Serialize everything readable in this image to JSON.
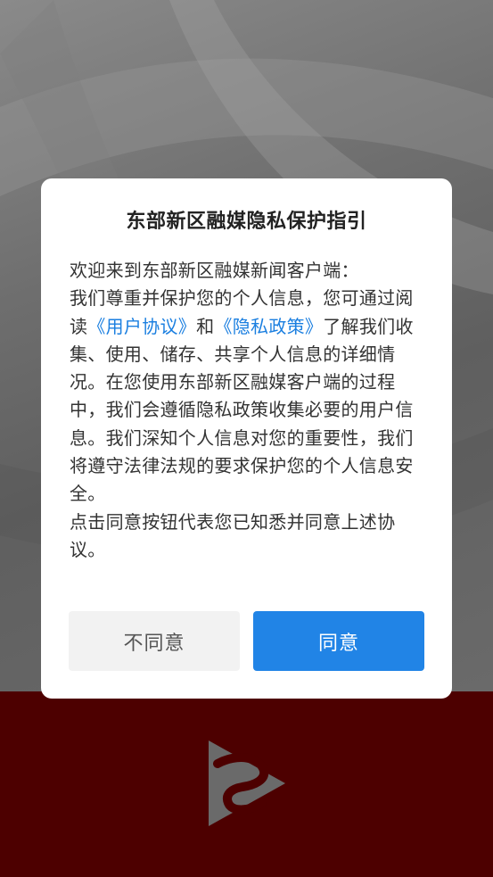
{
  "dialog": {
    "title": "东部新区融媒隐私保护指引",
    "body": {
      "greeting": "欢迎来到东部新区融媒新闻客户端：",
      "p1_before": "我们尊重并保护您的个人信息，您可通过阅读",
      "link_user_agreement": "《用户协议》",
      "p1_and": "和",
      "link_privacy_policy": "《隐私政策》",
      "p1_after": "了解我们收集、使用、储存、共享个人信息的详细情况。在您使用东部新区融媒客户端的过程中，我们会遵循隐私政策收集必要的用户信息。我们深知个人信息对您的重要性，我们将遵守法律法规的要求保护您的个人信息安全。",
      "p2": "点击同意按钮代表您已知悉并同意上述协议。"
    },
    "buttons": {
      "disagree": "不同意",
      "agree": "同意"
    }
  },
  "colors": {
    "link": "#1b7fe0",
    "agree_button": "#2184e6",
    "disagree_button": "#f2f2f2",
    "bottom_background": "#4d0000"
  },
  "icons": {
    "logo": "app-logo-icon"
  }
}
